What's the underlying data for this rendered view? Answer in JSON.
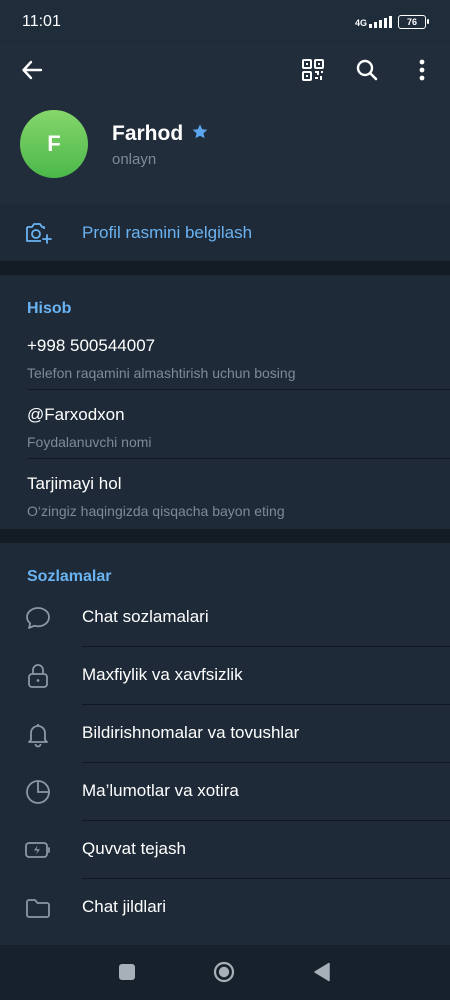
{
  "statusbar": {
    "time": "11:01",
    "network": "4G",
    "battery": "76"
  },
  "header": {
    "avatar_initial": "F",
    "name": "Farhod",
    "presence": "onlayn",
    "icons": [
      "back-arrow-icon",
      "qr-code-icon",
      "search-icon",
      "more-vertical-icon"
    ]
  },
  "set_photo": {
    "label": "Profil rasmini belgilash"
  },
  "account": {
    "title": "Hisob",
    "items": [
      {
        "value": "+998 500544007",
        "hint": "Telefon raqamini almashtirish uchun bosing"
      },
      {
        "value": "@Farxodxon",
        "hint": "Foydalanuvchi nomi"
      },
      {
        "value": "Tarjimayi hol",
        "hint": "O‘zingiz haqingizda qisqacha bayon eting"
      }
    ]
  },
  "settings": {
    "title": "Sozlamalar",
    "items": [
      {
        "label": "Chat sozlamalari",
        "icon": "chat-bubble-icon"
      },
      {
        "label": "Maxfiylik va xavfsizlik",
        "icon": "lock-icon"
      },
      {
        "label": "Bildirishnomalar va tovushlar",
        "icon": "bell-icon"
      },
      {
        "label": "Ma’lumotlar va xotira",
        "icon": "clock-pie-icon"
      },
      {
        "label": "Quvvat tejash",
        "icon": "battery-charge-icon"
      },
      {
        "label": "Chat jildlari",
        "icon": "folder-icon"
      }
    ]
  },
  "colors": {
    "background": "#17212b",
    "header": "#212d3b",
    "section": "#1e2a37",
    "accent": "#6ab3f3",
    "muted": "#7c8b99",
    "avatar": "#5cc45a"
  }
}
